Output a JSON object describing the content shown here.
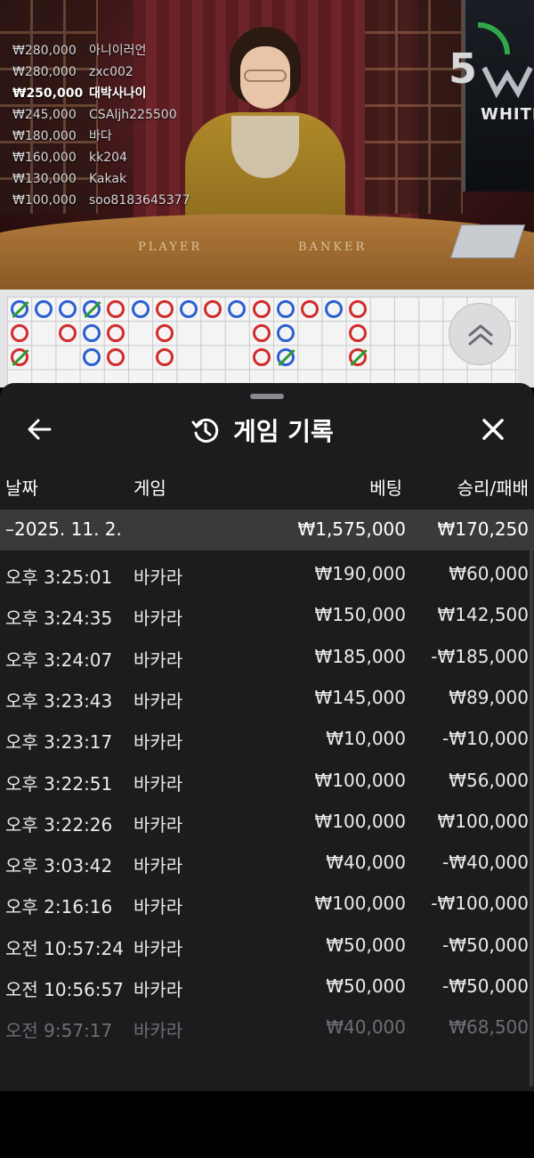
{
  "video": {
    "table_labels": {
      "player": "PLAYER",
      "banker": "BANKER"
    },
    "timer": "5",
    "brand": "WHITE",
    "bets": [
      {
        "amount": "₩280,000",
        "name": "아니이러언",
        "bold": false
      },
      {
        "amount": "₩280,000",
        "name": "zxc002",
        "bold": false
      },
      {
        "amount": "₩250,000",
        "name": "대박사나이",
        "bold": true
      },
      {
        "amount": "₩245,000",
        "name": "CSAljh225500",
        "bold": false
      },
      {
        "amount": "₩180,000",
        "name": "바다",
        "bold": false
      },
      {
        "amount": "₩160,000",
        "name": "kk204",
        "bold": false
      },
      {
        "amount": "₩130,000",
        "name": "Kakak",
        "bold": false
      },
      {
        "amount": "₩100,000",
        "name": "soo8183645377",
        "bold": false
      }
    ]
  },
  "roadmap": {
    "colors": {
      "banker": "#d22b2b",
      "player": "#2b5fd2",
      "tie": "#2e9a2e"
    },
    "columns": [
      [
        "P/",
        "B",
        "B/"
      ],
      [
        "P"
      ],
      [
        "P",
        "B"
      ],
      [
        "P/",
        "P",
        "P"
      ],
      [
        "B",
        "B",
        "B"
      ],
      [
        "P"
      ],
      [
        "B",
        "B",
        "B"
      ],
      [
        "P"
      ],
      [
        "B"
      ],
      [
        "P"
      ],
      [
        "B",
        "B",
        "B"
      ],
      [
        "P",
        "P",
        "P/"
      ],
      [
        "B"
      ],
      [
        "P"
      ],
      [
        "B",
        "B",
        "B/"
      ]
    ]
  },
  "sheet": {
    "title": "게임 기록",
    "headers": {
      "date": "날짜",
      "game": "게임",
      "bet": "베팅",
      "winloss": "승리/패배"
    },
    "date_group": {
      "date": "–2025. 11. 2.",
      "bet": "₩1,575,000",
      "winloss": "₩170,250"
    },
    "rows": [
      {
        "time": "오후 3:25:01",
        "game": "바카라",
        "bet": "₩190,000",
        "winloss": "₩60,000"
      },
      {
        "time": "오후 3:24:35",
        "game": "바카라",
        "bet": "₩150,000",
        "winloss": "₩142,500"
      },
      {
        "time": "오후 3:24:07",
        "game": "바카라",
        "bet": "₩185,000",
        "winloss": "-₩185,000"
      },
      {
        "time": "오후 3:23:43",
        "game": "바카라",
        "bet": "₩145,000",
        "winloss": "₩89,000"
      },
      {
        "time": "오후 3:23:17",
        "game": "바카라",
        "bet": "₩10,000",
        "winloss": "-₩10,000"
      },
      {
        "time": "오후 3:22:51",
        "game": "바카라",
        "bet": "₩100,000",
        "winloss": "₩56,000"
      },
      {
        "time": "오후 3:22:26",
        "game": "바카라",
        "bet": "₩100,000",
        "winloss": "₩100,000"
      },
      {
        "time": "오후 3:03:42",
        "game": "바카라",
        "bet": "₩40,000",
        "winloss": "-₩40,000"
      },
      {
        "time": "오후 2:16:16",
        "game": "바카라",
        "bet": "₩100,000",
        "winloss": "-₩100,000"
      },
      {
        "time": "오전 10:57:24",
        "game": "바카라",
        "bet": "₩50,000",
        "winloss": "-₩50,000"
      },
      {
        "time": "오전 10:56:57",
        "game": "바카라",
        "bet": "₩50,000",
        "winloss": "-₩50,000"
      },
      {
        "time": "오전 9:57:17",
        "game": "바카라",
        "bet": "₩40,000",
        "winloss": "₩68,500",
        "faded": true
      }
    ]
  }
}
